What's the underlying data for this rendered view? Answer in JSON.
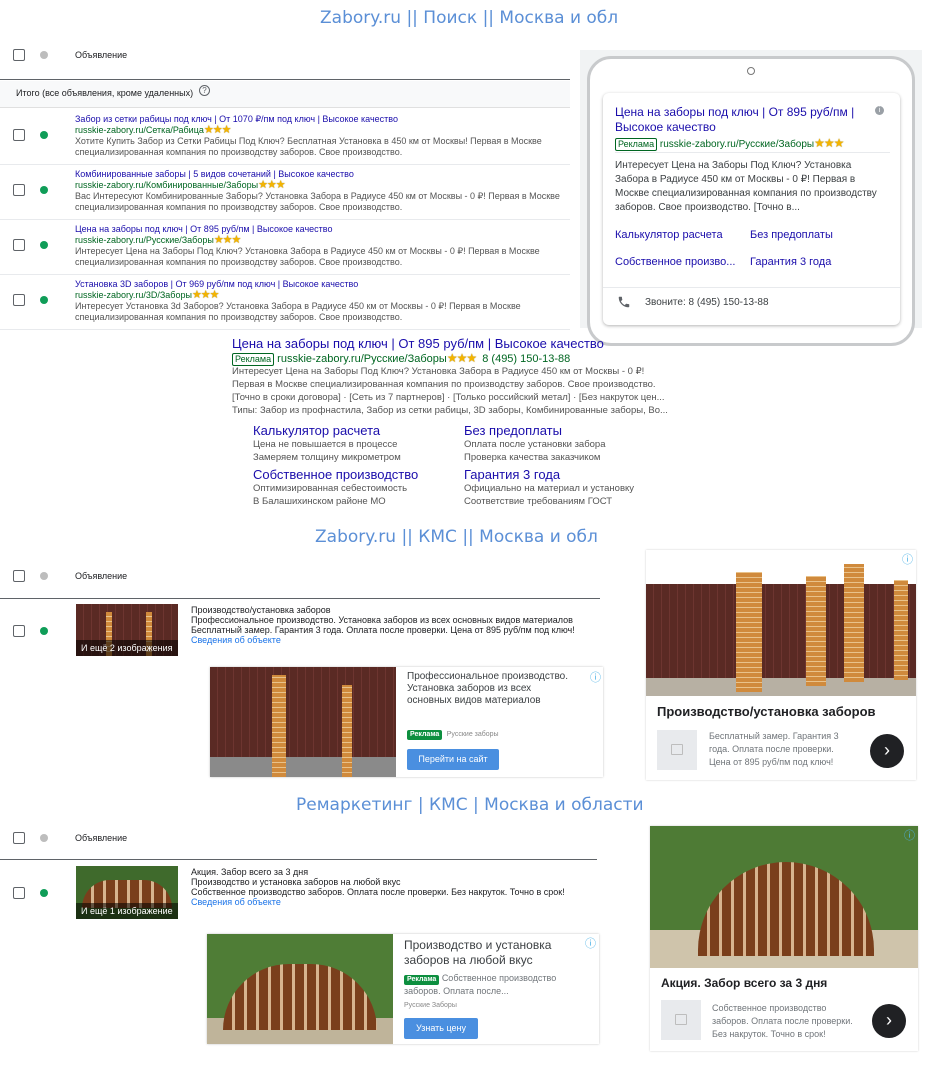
{
  "sections": {
    "search_title": "Zabory.ru || Поиск || Москва и обл",
    "kms_title": "Zabory.ru || КМС || Москва и обл",
    "remarketing_title": "Ремаркетинг | КМС | Москва и области"
  },
  "table": {
    "header_label": "Объявление",
    "total_label": "Итого (все объявления, кроме удаленных)"
  },
  "search_ads": [
    {
      "title": "Забор из сетки рабицы под ключ | От 1070 ₽/пм под ключ | Высокое качество",
      "url": "russkie-zabory.ru/Сетка/Рабица",
      "desc1": "Хотите Купить Забор из Сетки Рабицы Под Ключ? Бесплатная Установка в 450 км от Москвы! Первая в Москве",
      "desc2": "специализированная компания по производству заборов. Свое производство."
    },
    {
      "title": "Комбинированные заборы | 5 видов сочетаний | Высокое качество",
      "url": "russkie-zabory.ru/Комбинированные/Заборы",
      "desc1": "Вас Интересуют Комбинированные Заборы? Установка Забора в Радиусе 450 км от Москвы - 0 ₽! Первая в Москве",
      "desc2": "специализированная компания по производству заборов. Свое производство."
    },
    {
      "title": "Цена на заборы под ключ | От 895 руб/пм | Высокое качество",
      "url": "russkie-zabory.ru/Русские/Заборы",
      "desc1": "Интересует Цена на Заборы Под Ключ? Установка Забора в Радиусе 450 км от Москвы - 0 ₽! Первая в Москве",
      "desc2": "специализированная компания по производству заборов. Свое производство."
    },
    {
      "title": "Установка 3D заборов | От 969 руб/пм под ключ | Высокое качество",
      "url": "russkie-zabory.ru/3D/Заборы",
      "desc1": "Интересует Установка 3d Заборов? Установка Забора в Радиусе 450 км от Москвы - 0 ₽! Первая в Москве",
      "desc2": "специализированная компания по производству заборов. Свое производство."
    }
  ],
  "mobile_preview": {
    "title": "Цена на заборы под ключ | От 895 руб/пм | Высокое качество",
    "badge": "Реклама",
    "url": "russkie-zabory.ru/Русские/Заборы",
    "desc": "Интересует Цена на Заборы Под Ключ? Установка Забора в Радиусе 450 км от Москвы - 0 ₽! Первая в Москве специализированная компания по производству заборов. Свое производство. [Точно в...",
    "links": [
      "Калькулятор расчета",
      "Без предоплаты",
      "Собственное произво...",
      "Гарантия 3 года"
    ],
    "call": "Звоните: 8 (495) 150-13-88"
  },
  "desktop_preview": {
    "title": "Цена на заборы под ключ | От 895 руб/пм | Высокое качество",
    "badge": "Реклама",
    "url": "russkie-zabory.ru/Русские/Заборы",
    "phone": "8 (495) 150-13-88",
    "line1": "Интересует Цена на Заборы Под Ключ? Установка Забора в Радиусе 450 км от Москвы - 0 ₽!",
    "line2": "Первая в Москве специализированная компания по производству заборов. Свое производство.",
    "line3": "[Точно в сроки договора] · [Сеть из 7 партнеров] · [Только российский метал] · [Без накруток цен...",
    "line4": "Типы: Забор из профнастила, Забор из сетки рабицы, 3D заборы, Комбинированные заборы, Во...",
    "sitelinks": [
      {
        "title": "Калькулятор расчета",
        "d1": "Цена не повышается в процессе",
        "d2": "Замеряем толщину микрометром"
      },
      {
        "title": "Без предоплаты",
        "d1": "Оплата после установки забора",
        "d2": "Проверка качества заказчиком"
      },
      {
        "title": "Собственное производство",
        "d1": "Оптимизированная себестоимость",
        "d2": "В Балашихинском районе МО"
      },
      {
        "title": "Гарантия 3 года",
        "d1": "Официально на материал и установку",
        "d2": "Соответствие требованиям ГОСТ"
      }
    ]
  },
  "kms_ad": {
    "thumb_label": "И ещё 2 изображения",
    "line1": "Производство/установка заборов",
    "line2": "Профессиональное производство. Установка заборов из всех основных видов материалов",
    "line3": "Бесплатный замер. Гарантия 3 года. Оплата после проверки. Цена от 895 руб/пм под ключ!",
    "link": "Сведения об объекте",
    "banner_text": "Профессиональное производство. Установка заборов из всех основных видов материалов",
    "banner_badge": "Реклама",
    "banner_brand": "Русские заборы",
    "banner_btn": "Перейти на сайт",
    "card_title": "Производство/установка заборов",
    "card_desc": "Бесплатный замер. Гарантия 3 года. Оплата после проверки. Цена от 895 руб/пм под ключ!"
  },
  "remarketing_ad": {
    "thumb_label": "И ещё 1 изображение",
    "line1": "Акция. Забор всего за 3 дня",
    "line2": "Производство и установка заборов на любой вкус",
    "line3": "Собственное производство заборов. Оплата после проверки. Без накруток. Точно в срок!",
    "link": "Сведения об объекте",
    "banner_title": "Производство и установка заборов на любой вкус",
    "banner_badge": "Реклама",
    "banner_desc": "Собственное производство заборов. Оплата после...",
    "banner_brand": "Русские Заборы",
    "banner_btn": "Узнать цену",
    "card_title": "Акция. Забор всего за 3 дня",
    "card_desc": "Собственное производство заборов. Оплата после проверки. Без накруток. Точно в срок!"
  },
  "colors": {
    "link": "#1a0dab",
    "url": "#006621",
    "header": "#5b8fd6",
    "status": "#0f9d58"
  },
  "icons": {
    "info": "info-icon",
    "help": "help-icon",
    "phone": "phone-icon",
    "arrow": "arrow-right-icon",
    "image": "image-placeholder-icon"
  }
}
